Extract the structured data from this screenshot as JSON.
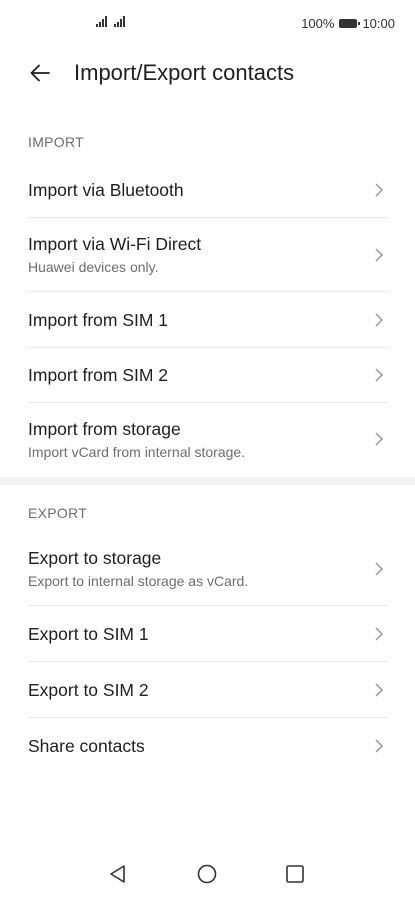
{
  "status": {
    "battery_text": "100%",
    "time": "10:00"
  },
  "appbar": {
    "title": "Import/Export contacts"
  },
  "import_section": {
    "header": "IMPORT",
    "items": [
      {
        "label": "Import via Bluetooth",
        "sub": ""
      },
      {
        "label": "Import via Wi-Fi Direct",
        "sub": "Huawei devices only."
      },
      {
        "label": "Import from SIM 1",
        "sub": ""
      },
      {
        "label": "Import from SIM 2",
        "sub": ""
      },
      {
        "label": "Import from storage",
        "sub": "Import vCard from internal storage."
      }
    ]
  },
  "export_section": {
    "header": "EXPORT",
    "items": [
      {
        "label": "Export to storage",
        "sub": "Export to internal storage as vCard."
      },
      {
        "label": "Export to SIM 1",
        "sub": ""
      },
      {
        "label": "Export to SIM 2",
        "sub": ""
      },
      {
        "label": "Share contacts",
        "sub": ""
      }
    ]
  },
  "navbar": {
    "buttons": [
      "back-triangle-icon",
      "home-circle-icon",
      "recents-square-icon"
    ]
  }
}
